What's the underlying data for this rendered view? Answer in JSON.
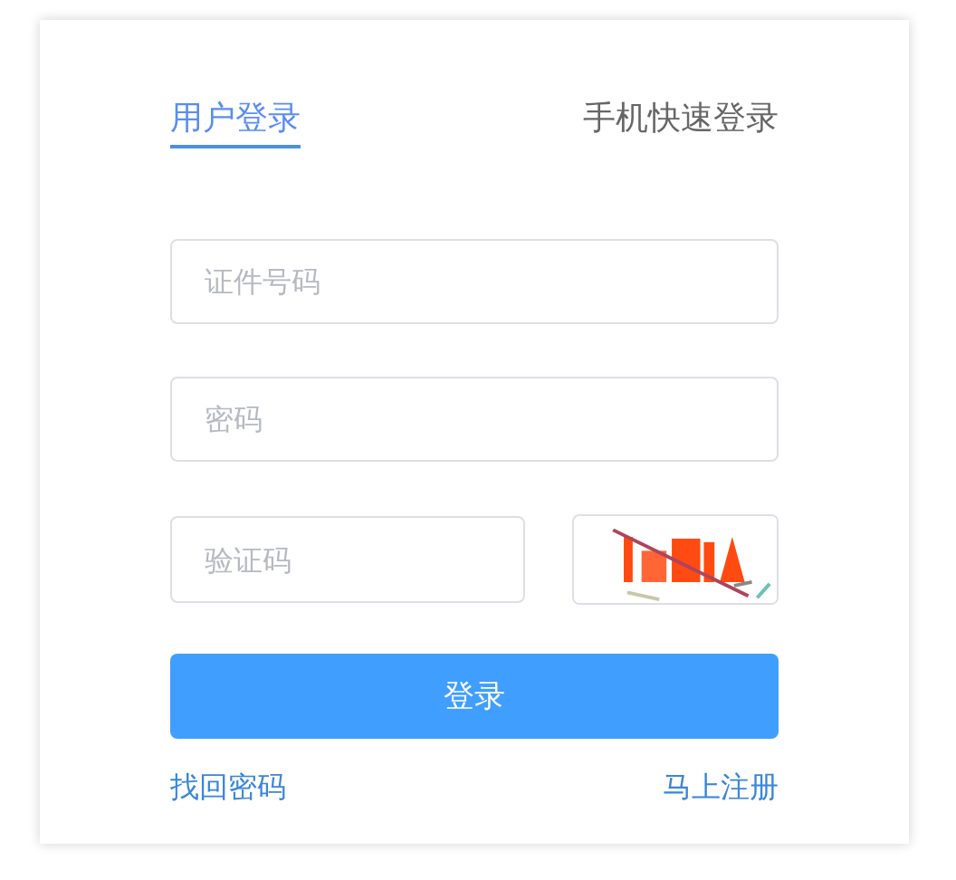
{
  "tabs": [
    {
      "label": "用户登录",
      "selected": true
    },
    {
      "label": "手机快速登录",
      "selected": false
    }
  ],
  "fields": [
    {
      "placeholder": "证件号码"
    },
    {
      "placeholder": "密码"
    }
  ],
  "captcha": {
    "placeholder": "验证码"
  },
  "submit_button": "登录",
  "links": [
    "找回密码",
    "马上注册"
  ]
}
